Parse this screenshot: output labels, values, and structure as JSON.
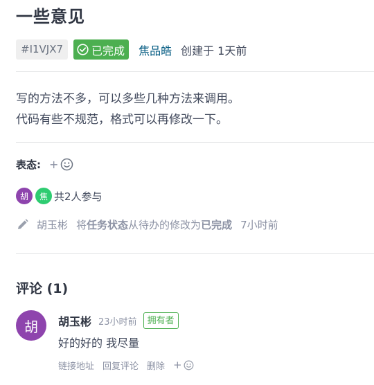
{
  "issue": {
    "title": "一些意见",
    "id": "#I1VJX7",
    "status": "已完成",
    "author": "焦品皓",
    "created": "创建于 1天前",
    "description_lines": [
      "写的方法不多，可以多些几种方法来调用。",
      "代码有些不规范，格式可以再修改一下。"
    ]
  },
  "reactions": {
    "label": "表态:",
    "add_symbol": "+"
  },
  "participants": {
    "avatars": [
      {
        "initial": "胡",
        "color": "#8e44ad"
      },
      {
        "initial": "焦",
        "color": "#2ecc71"
      }
    ],
    "summary": "共2人参与"
  },
  "activity": {
    "user": "胡玉彬",
    "prefix": "将",
    "field": "任务状态",
    "middle": "从待办的修改为",
    "value": "已完成",
    "time": "7小时前"
  },
  "comments": {
    "heading": "评论 (1)",
    "items": [
      {
        "avatar": "胡",
        "author": "胡玉彬",
        "time": "23小时前",
        "badge": "拥有者",
        "text": "好的好的 我尽量",
        "actions": {
          "link": "链接地址",
          "reply": "回复评论",
          "delete": "删除",
          "add": "+"
        }
      }
    ]
  },
  "colors": {
    "accent_green": "#4caf50",
    "link": "#005980",
    "muted": "#8c92a4"
  }
}
